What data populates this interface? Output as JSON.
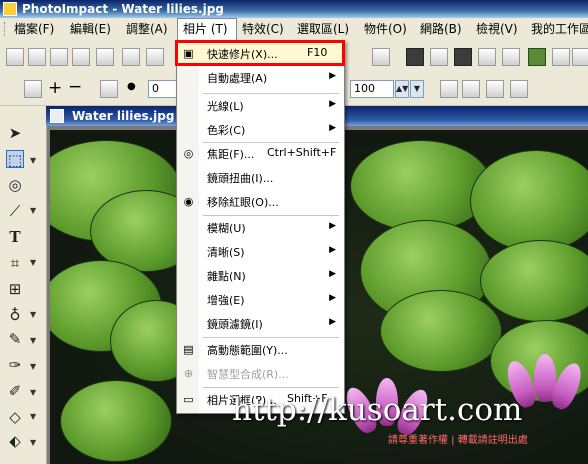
{
  "app": {
    "title": "PhotoImpact - Water lilies.jpg"
  },
  "menubar": {
    "items": [
      "檔案(F)",
      "編輯(E)",
      "調整(A)",
      "相片 (T)",
      "特效(C)",
      "選取區(L)",
      "物件(O)",
      "網路(B)",
      "檢視(V)",
      "我的工作區"
    ]
  },
  "toolbar": {
    "zoom_value": "0",
    "opacity_value": "100"
  },
  "document": {
    "title": "Water lilies.jpg (10"
  },
  "photo_menu": {
    "items": [
      {
        "label": "快速修片(X)...",
        "shortcut": "F10",
        "icon": "quick-fix-icon"
      },
      {
        "label": "自動處理(A)",
        "submenu": true
      },
      {
        "label": "光線(L)",
        "submenu": true
      },
      {
        "label": "色彩(C)",
        "submenu": true
      },
      {
        "label": "焦距(F)...",
        "shortcut": "Ctrl+Shift+F",
        "icon": "focus-icon"
      },
      {
        "label": "鏡頭扭曲(I)..."
      },
      {
        "label": "移除紅眼(O)...",
        "icon": "red-eye-icon"
      },
      {
        "label": "模糊(U)",
        "submenu": true
      },
      {
        "label": "清晰(S)",
        "submenu": true
      },
      {
        "label": "雜點(N)",
        "submenu": true
      },
      {
        "label": "增強(E)",
        "submenu": true
      },
      {
        "label": "鏡頭濾鏡(I)",
        "submenu": true
      },
      {
        "label": "高動態範圍(Y)...",
        "icon": "hdr-icon"
      },
      {
        "label": "智慧型合成(R)...",
        "icon": "smart-merge-icon",
        "disabled": true
      },
      {
        "label": "相片選框(P)...",
        "shortcut": "Shift+F",
        "icon": "photo-frame-icon"
      }
    ]
  },
  "watermark": {
    "main": "http://kusoart.com",
    "sub": "請尊重著作權 | 轉載請註明出處"
  },
  "colors": {
    "highlight": "#ff0000",
    "titlebar": "#0a246a"
  }
}
